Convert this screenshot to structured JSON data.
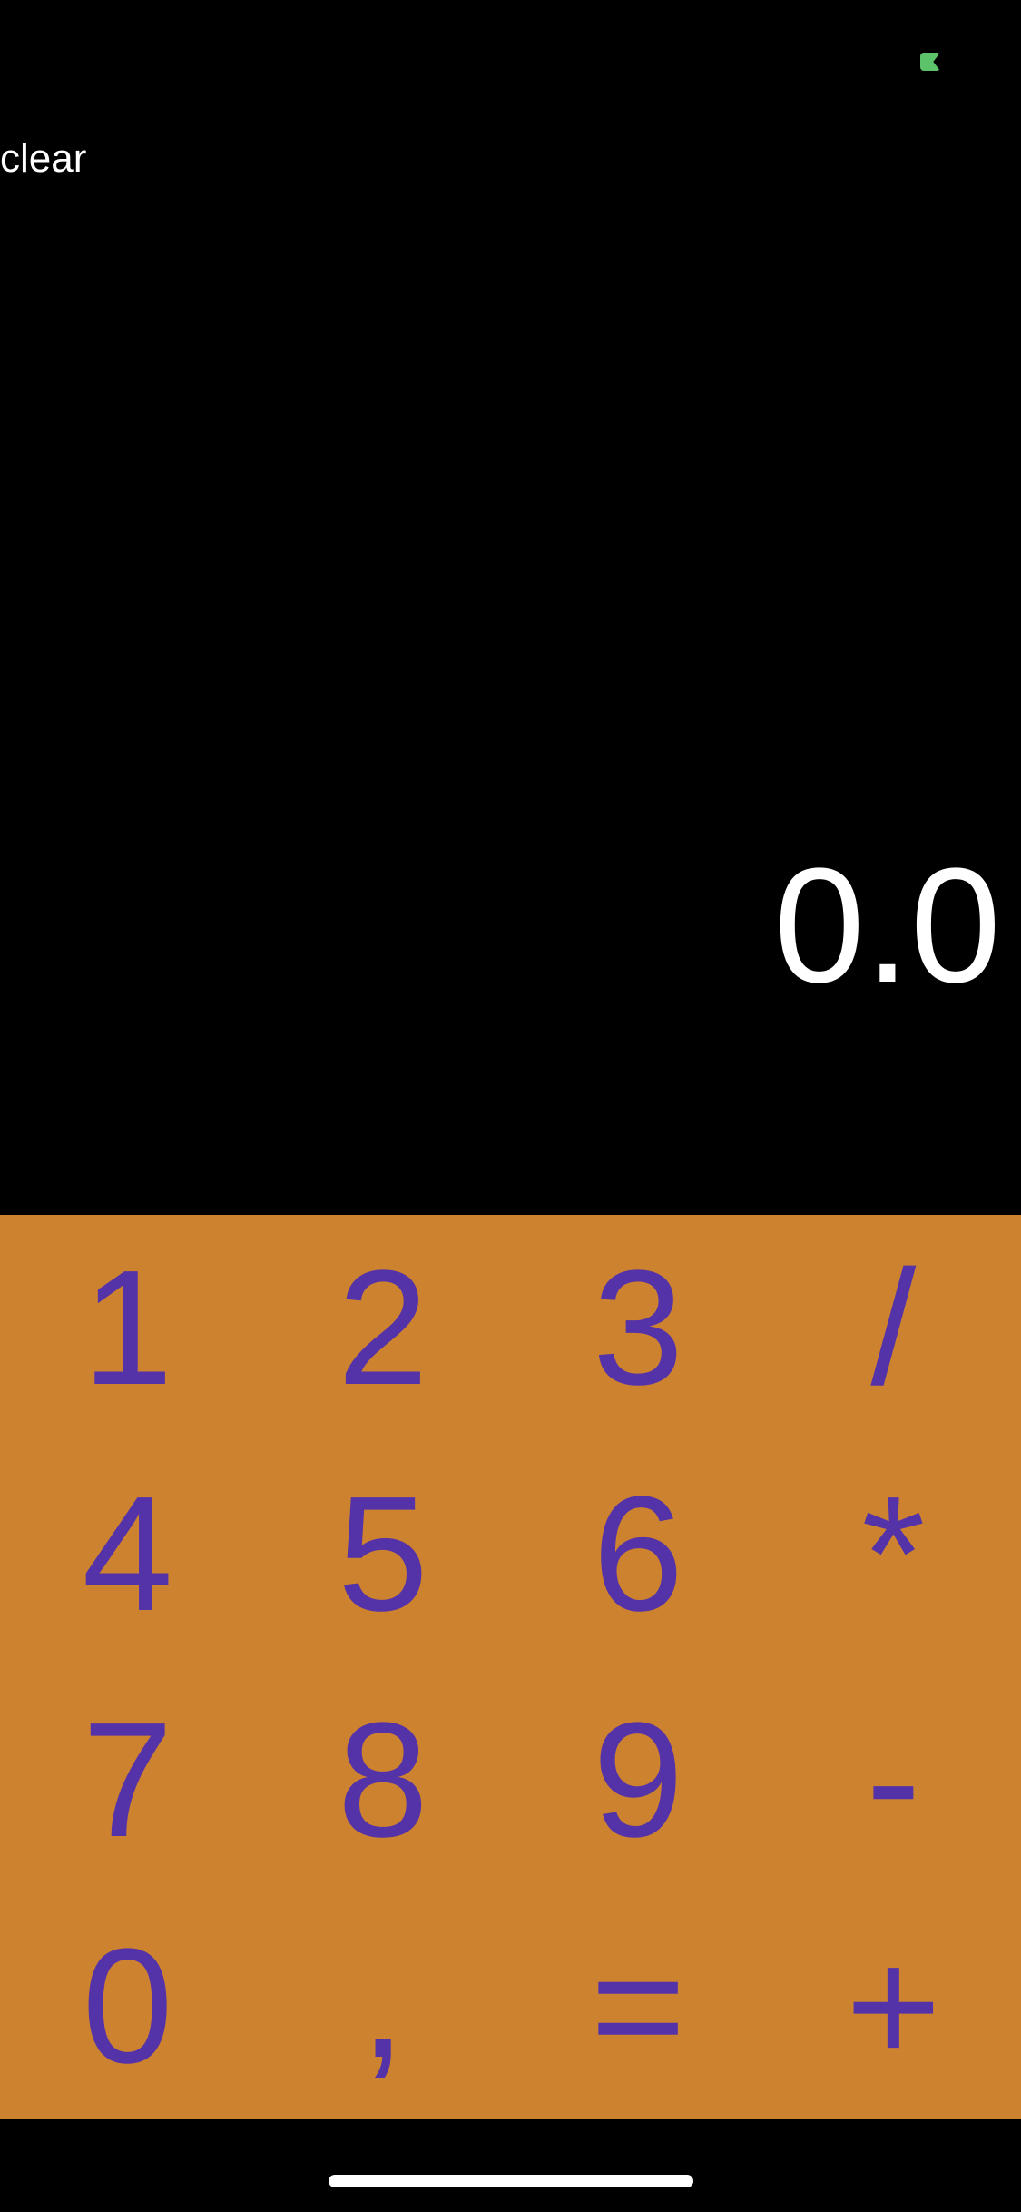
{
  "status_bar": {
    "indicator_color": "#5cc36a"
  },
  "toolbar": {
    "clear_label": "clear"
  },
  "display": {
    "value": "0.0"
  },
  "keypad": {
    "background": "#cd8230",
    "key_color": "#5432a8",
    "keys": [
      {
        "label": "1",
        "name": "key-1"
      },
      {
        "label": "2",
        "name": "key-2"
      },
      {
        "label": "3",
        "name": "key-3"
      },
      {
        "label": "/",
        "name": "key-divide"
      },
      {
        "label": "4",
        "name": "key-4"
      },
      {
        "label": "5",
        "name": "key-5"
      },
      {
        "label": "6",
        "name": "key-6"
      },
      {
        "label": "*",
        "name": "key-multiply"
      },
      {
        "label": "7",
        "name": "key-7"
      },
      {
        "label": "8",
        "name": "key-8"
      },
      {
        "label": "9",
        "name": "key-9"
      },
      {
        "label": "-",
        "name": "key-subtract"
      },
      {
        "label": "0",
        "name": "key-0"
      },
      {
        "label": ",",
        "name": "key-comma"
      },
      {
        "label": "=",
        "name": "key-equals"
      },
      {
        "label": "+",
        "name": "key-add"
      }
    ]
  }
}
